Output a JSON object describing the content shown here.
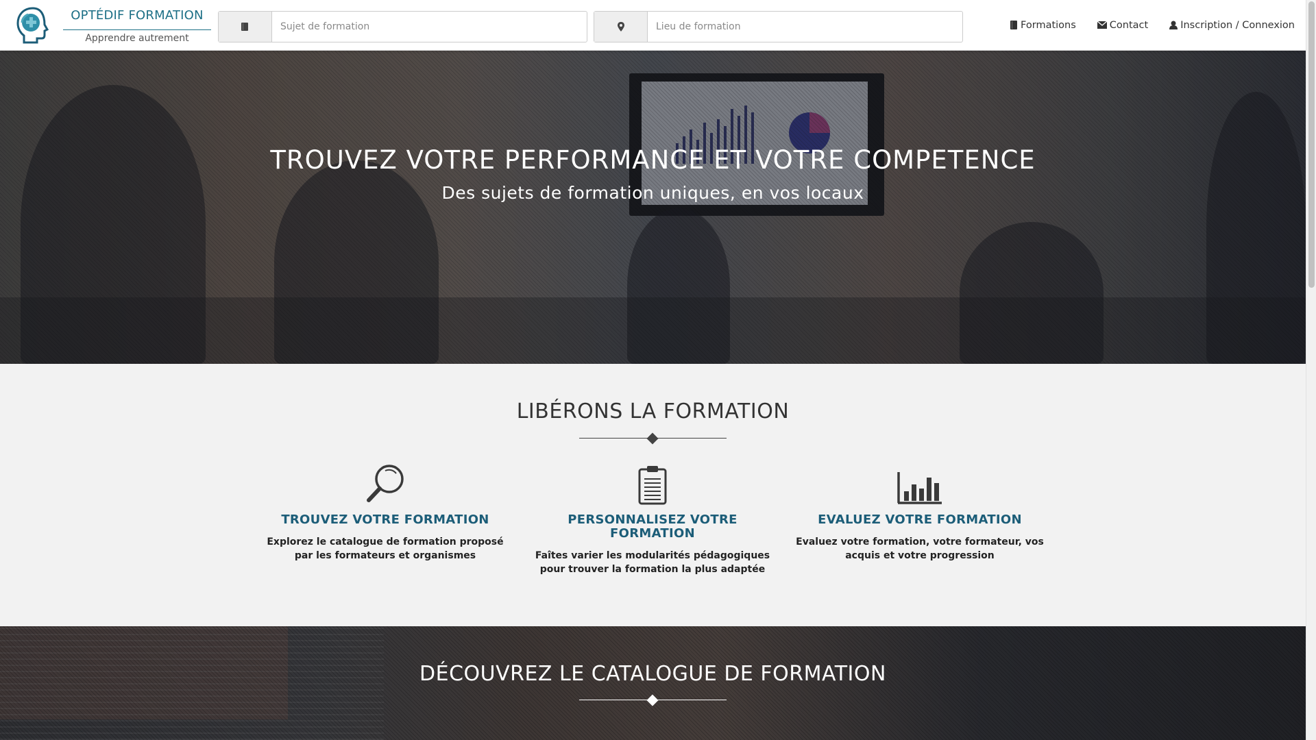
{
  "brand": {
    "name": "OPTÉDIF FORMATION",
    "tagline": "Apprendre autrement",
    "accent_color": "#1c6f86"
  },
  "search": {
    "subject": {
      "placeholder": "Sujet de formation",
      "icon": "book-icon"
    },
    "location": {
      "placeholder": "Lieu de formation",
      "icon": "map-marker-icon"
    }
  },
  "nav": {
    "items": [
      {
        "label": "Formations",
        "icon": "book-icon"
      },
      {
        "label": "Contact",
        "icon": "envelope-icon"
      },
      {
        "label": "Inscription / Connexion",
        "icon": "user-icon"
      }
    ]
  },
  "hero": {
    "title": "TROUVEZ VOTRE PERFORMANCE ET VOTRE COMPETENCE",
    "subtitle": "Des sujets de formation uniques, en vos locaux"
  },
  "features": {
    "title": "LIBÉRONS LA FORMATION",
    "items": [
      {
        "icon": "magnifier-icon",
        "title": "TROUVEZ VOTRE FORMATION",
        "text": "Explorez le catalogue de formation proposé par les formateurs et organismes"
      },
      {
        "icon": "clipboard-icon",
        "title": "PERSONNALISEZ VOTRE FORMATION",
        "text": "Faîtes varier les modularités pédagogiques pour trouver la formation la plus adaptée"
      },
      {
        "icon": "bar-chart-icon",
        "title": "EVALUEZ VOTRE FORMATION",
        "text": "Evaluez votre formation, votre formateur, vos acquis et votre progression"
      }
    ],
    "heading_color": "#1c5d78"
  },
  "catalogue": {
    "title": "DÉCOUVREZ LE CATALOGUE DE FORMATION"
  }
}
